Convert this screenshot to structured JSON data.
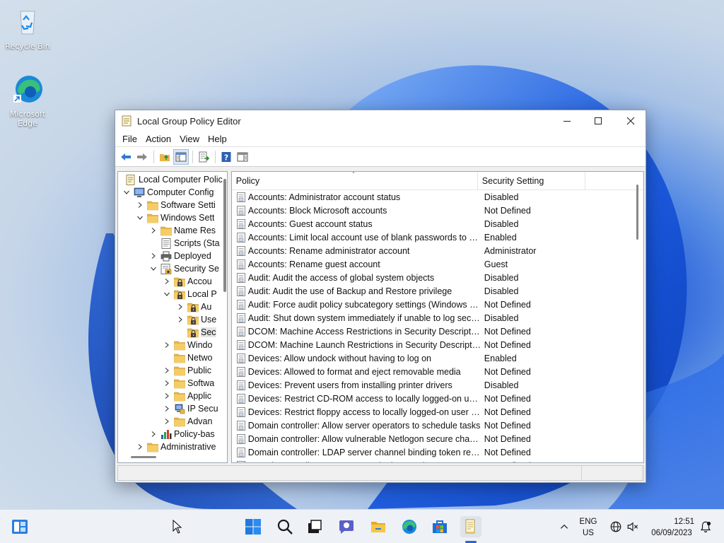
{
  "desktop": {
    "icons": [
      {
        "label": "Recycle Bin"
      },
      {
        "label": "Microsoft Edge"
      }
    ]
  },
  "window": {
    "title": "Local Group Policy Editor",
    "menu": [
      "File",
      "Action",
      "View",
      "Help"
    ],
    "tree": [
      {
        "label": "Local Computer Polic",
        "depth": 0,
        "exp": "",
        "icon": "policy-doc-icon"
      },
      {
        "label": "Computer Config",
        "depth": 0,
        "exp": "down",
        "icon": "computer-icon"
      },
      {
        "label": "Software Setti",
        "depth": 1,
        "exp": "right",
        "icon": "folder-icon"
      },
      {
        "label": "Windows Sett",
        "depth": 1,
        "exp": "down",
        "icon": "folder-icon"
      },
      {
        "label": "Name Res",
        "depth": 2,
        "exp": "right",
        "icon": "folder-icon"
      },
      {
        "label": "Scripts (Sta",
        "depth": 2,
        "exp": "",
        "icon": "script-icon"
      },
      {
        "label": "Deployed",
        "depth": 2,
        "exp": "right",
        "icon": "printer-icon"
      },
      {
        "label": "Security Se",
        "depth": 2,
        "exp": "down",
        "icon": "security-settings-icon"
      },
      {
        "label": "Accou",
        "depth": 3,
        "exp": "right",
        "icon": "lock-folder-icon"
      },
      {
        "label": "Local P",
        "depth": 3,
        "exp": "down",
        "icon": "lock-folder-icon"
      },
      {
        "label": "Au",
        "depth": 4,
        "exp": "right",
        "icon": "lock-folder-icon"
      },
      {
        "label": "Use",
        "depth": 4,
        "exp": "right",
        "icon": "lock-folder-icon"
      },
      {
        "label": "Sec",
        "depth": 4,
        "exp": "",
        "icon": "lock-folder-icon",
        "selected": true
      },
      {
        "label": "Windo",
        "depth": 3,
        "exp": "right",
        "icon": "folder-icon"
      },
      {
        "label": "Netwo",
        "depth": 3,
        "exp": "",
        "icon": "folder-icon"
      },
      {
        "label": "Public",
        "depth": 3,
        "exp": "right",
        "icon": "folder-icon"
      },
      {
        "label": "Softwa",
        "depth": 3,
        "exp": "right",
        "icon": "folder-icon"
      },
      {
        "label": "Applic",
        "depth": 3,
        "exp": "right",
        "icon": "folder-icon"
      },
      {
        "label": "IP Secu",
        "depth": 3,
        "exp": "right",
        "icon": "ip-security-icon"
      },
      {
        "label": "Advan",
        "depth": 3,
        "exp": "right",
        "icon": "folder-icon"
      },
      {
        "label": "Policy-bas",
        "depth": 2,
        "exp": "right",
        "icon": "chart-icon"
      },
      {
        "label": "Administrative",
        "depth": 1,
        "exp": "right",
        "icon": "folder-icon"
      }
    ],
    "columns": {
      "policy": "Policy",
      "setting": "Security Setting"
    },
    "rows": [
      {
        "policy": "Accounts: Administrator account status",
        "setting": "Disabled"
      },
      {
        "policy": "Accounts: Block Microsoft accounts",
        "setting": "Not Defined"
      },
      {
        "policy": "Accounts: Guest account status",
        "setting": "Disabled"
      },
      {
        "policy": "Accounts: Limit local account use of blank passwords to co...",
        "setting": "Enabled"
      },
      {
        "policy": "Accounts: Rename administrator account",
        "setting": "Administrator"
      },
      {
        "policy": "Accounts: Rename guest account",
        "setting": "Guest"
      },
      {
        "policy": "Audit: Audit the access of global system objects",
        "setting": "Disabled"
      },
      {
        "policy": "Audit: Audit the use of Backup and Restore privilege",
        "setting": "Disabled"
      },
      {
        "policy": "Audit: Force audit policy subcategory settings (Windows Vis...",
        "setting": "Not Defined"
      },
      {
        "policy": "Audit: Shut down system immediately if unable to log secur...",
        "setting": "Disabled"
      },
      {
        "policy": "DCOM: Machine Access Restrictions in Security Descriptor D...",
        "setting": "Not Defined"
      },
      {
        "policy": "DCOM: Machine Launch Restrictions in Security Descriptor ...",
        "setting": "Not Defined"
      },
      {
        "policy": "Devices: Allow undock without having to log on",
        "setting": "Enabled"
      },
      {
        "policy": "Devices: Allowed to format and eject removable media",
        "setting": "Not Defined"
      },
      {
        "policy": "Devices: Prevent users from installing printer drivers",
        "setting": "Disabled"
      },
      {
        "policy": "Devices: Restrict CD-ROM access to locally logged-on user ...",
        "setting": "Not Defined"
      },
      {
        "policy": "Devices: Restrict floppy access to locally logged-on user only",
        "setting": "Not Defined"
      },
      {
        "policy": "Domain controller: Allow server operators to schedule tasks",
        "setting": "Not Defined"
      },
      {
        "policy": "Domain controller: Allow vulnerable Netlogon secure chann...",
        "setting": "Not Defined"
      },
      {
        "policy": "Domain controller: LDAP server channel binding token requi...",
        "setting": "Not Defined"
      },
      {
        "policy": "Domain controller: LDAP server signing requirements",
        "setting": "Not Defined"
      }
    ]
  },
  "taskbar": {
    "language": "ENG",
    "region": "US",
    "time": "12:51",
    "date": "06/09/2023"
  },
  "colors": {
    "accent": "#2a64d6",
    "folder": "#e8b64a"
  }
}
